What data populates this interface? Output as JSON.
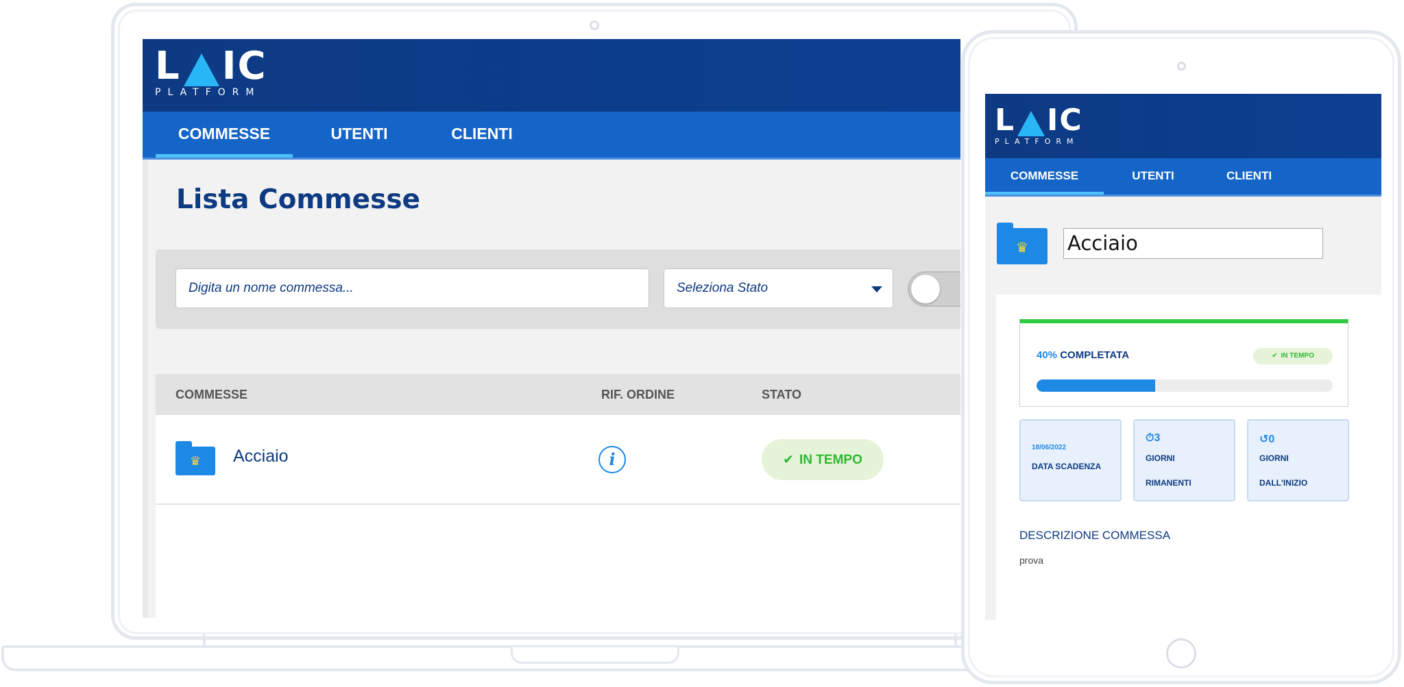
{
  "app": {
    "logo_text": "LAIC",
    "logo_subtitle": "PLATFORM"
  },
  "nav": {
    "tabs": [
      {
        "label": "COMMESSE",
        "active": true
      },
      {
        "label": "UTENTI",
        "active": false
      },
      {
        "label": "CLIENTI",
        "active": false
      }
    ]
  },
  "list_page": {
    "title": "Lista Commesse",
    "search": {
      "placeholder": "Digita un nome commessa...",
      "value": ""
    },
    "status_select": {
      "selected": "Seleziona Stato"
    },
    "toggle": {
      "on": false
    },
    "table": {
      "columns": [
        "COMMESSE",
        "RIF. ORDINE",
        "STATO"
      ],
      "rows": [
        {
          "name": "Acciaio",
          "status": "IN TEMPO",
          "icon": "folder-crown-icon"
        }
      ]
    }
  },
  "detail_page": {
    "title_value": "Acciaio",
    "progress": {
      "percent_label": "40%",
      "label": "COMPLETATA",
      "fraction": 0.4,
      "status": "IN TEMPO"
    },
    "stats": [
      {
        "top": "18/06/2022",
        "label_lines": [
          "DATA SCADENZA"
        ]
      },
      {
        "top": "3",
        "icon": "stopwatch-icon",
        "label_lines": [
          "GIORNI",
          "RIMANENTI"
        ]
      },
      {
        "top": "0",
        "icon": "history-icon",
        "label_lines": [
          "GIORNI",
          "DALL'INIZIO"
        ]
      }
    ],
    "description_title": "DESCRIZIONE COMMESSA",
    "description_text": "prova"
  },
  "colors": {
    "header_dark": "#0d3a82",
    "nav_blue": "#1565c8",
    "accent_blue": "#1e88e5",
    "tab_underline": "#4fc3f7",
    "success_green": "#2eb82e",
    "success_bg": "#e5f4d9"
  }
}
